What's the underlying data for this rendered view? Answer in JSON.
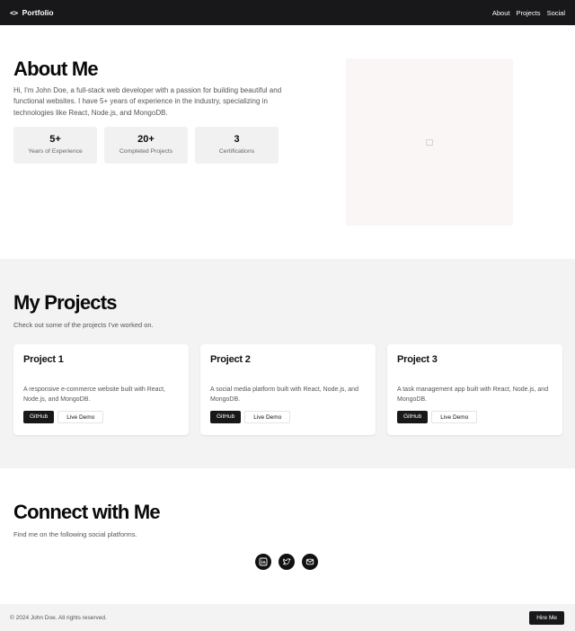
{
  "nav": {
    "brand": "Portfolio",
    "brand_icon": "<>",
    "links": [
      "About",
      "Projects",
      "Social"
    ]
  },
  "about": {
    "title": "About Me",
    "text": "Hi, I'm John Doe, a full-stack web developer with a passion for building beautiful and functional websites. I have 5+ years of experience in the industry, specializing in technologies like React, Node.js, and MongoDB.",
    "stats": [
      {
        "value": "5+",
        "label": "Years of Experience"
      },
      {
        "value": "20+",
        "label": "Completed Projects"
      },
      {
        "value": "3",
        "label": "Certifications"
      }
    ]
  },
  "projects": {
    "title": "My Projects",
    "subtitle": "Check out some of the projects I've worked on.",
    "items": [
      {
        "title": "Project 1",
        "description": "A responsive e-commerce website built with React, Node.js, and MongoDB.",
        "github_label": "GitHub",
        "demo_label": "Live Demo"
      },
      {
        "title": "Project 2",
        "description": "A social media platform built with React, Node.js, and MongoDB.",
        "github_label": "GitHub",
        "demo_label": "Live Demo"
      },
      {
        "title": "Project 3",
        "description": "A task management app built with React, Node.js, and MongoDB.",
        "github_label": "GitHub",
        "demo_label": "Live Demo"
      }
    ]
  },
  "connect": {
    "title": "Connect with Me",
    "subtitle": "Find me on the following social platforms.",
    "icons": [
      "linkedin-icon",
      "twitter-icon",
      "email-icon"
    ]
  },
  "footer": {
    "copyright": "© 2024 John Doe. All rights reserved.",
    "hire_label": "Hire Me"
  },
  "colors": {
    "dark": "#18181b",
    "section_gray": "#f3f3f3",
    "stat_bg": "#f1f1f2"
  }
}
